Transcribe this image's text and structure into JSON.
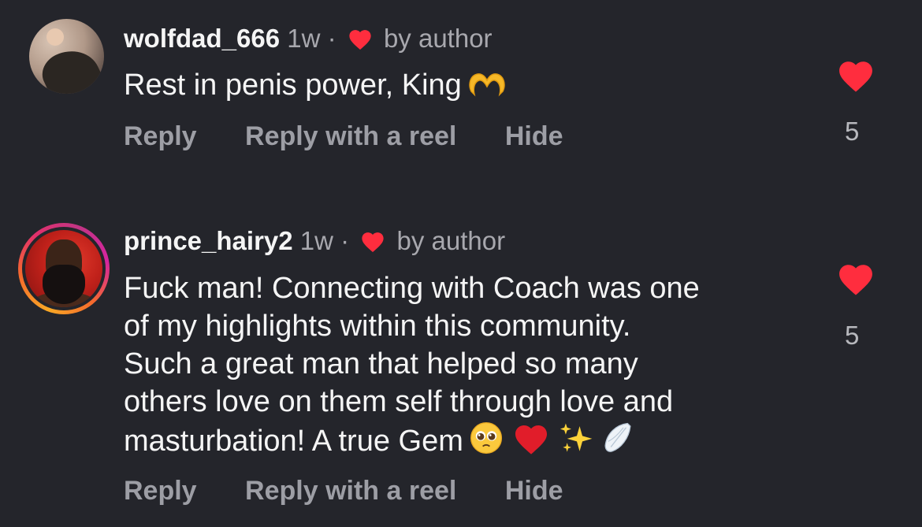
{
  "comments": [
    {
      "username": "wolfdad_666",
      "time": "1w",
      "separator": "·",
      "liked_by": "by author",
      "text": "Rest in penis power, King",
      "emoji_names": [
        "heart-hands-icon"
      ],
      "actions": {
        "reply": "Reply",
        "reel": "Reply with a reel",
        "hide": "Hide"
      },
      "likes": "5",
      "avatar_story_ring": false
    },
    {
      "username": "prince_hairy2",
      "time": "1w",
      "separator": "·",
      "liked_by": "by author",
      "text": "Fuck man! Connecting with Coach was one\nof my highlights within this community.\nSuch a great man that helped so many\nothers love on them self through love and\nmasturbation! A true Gem",
      "emoji_names": [
        "pleading-face-icon",
        "red-heart-icon",
        "sparkles-icon",
        "wing-icon"
      ],
      "actions": {
        "reply": "Reply",
        "reel": "Reply with a reel",
        "hide": "Hide"
      },
      "likes": "5",
      "avatar_story_ring": true
    }
  ],
  "colors": {
    "background": "#24252b",
    "heart": "#ff2d3e",
    "muted": "#a8a8ae",
    "ring_gradient": [
      "#f9a825",
      "#e1306c",
      "#c13584"
    ]
  }
}
